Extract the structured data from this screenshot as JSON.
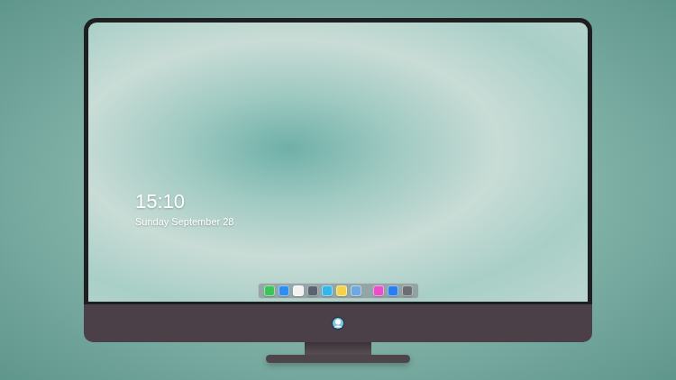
{
  "lock_screen": {
    "time": "15:10",
    "date": "Sunday September 28"
  },
  "dock": {
    "items": [
      {
        "kind": "app",
        "color": "#3cc35a"
      },
      {
        "kind": "app",
        "color": "#2f8cf0"
      },
      {
        "kind": "app",
        "color": "#f2f2f2"
      },
      {
        "kind": "app",
        "color": "#5a6470"
      },
      {
        "kind": "app",
        "color": "#36b6e8"
      },
      {
        "kind": "app",
        "color": "#f5d24a"
      },
      {
        "kind": "app",
        "color": "#6fa8dc"
      },
      {
        "kind": "separator",
        "color": "#9aa0a6"
      },
      {
        "kind": "app",
        "color": "#e84fc8"
      },
      {
        "kind": "app",
        "color": "#2a7ff0"
      },
      {
        "kind": "app",
        "color": "#6b6f75"
      }
    ]
  }
}
